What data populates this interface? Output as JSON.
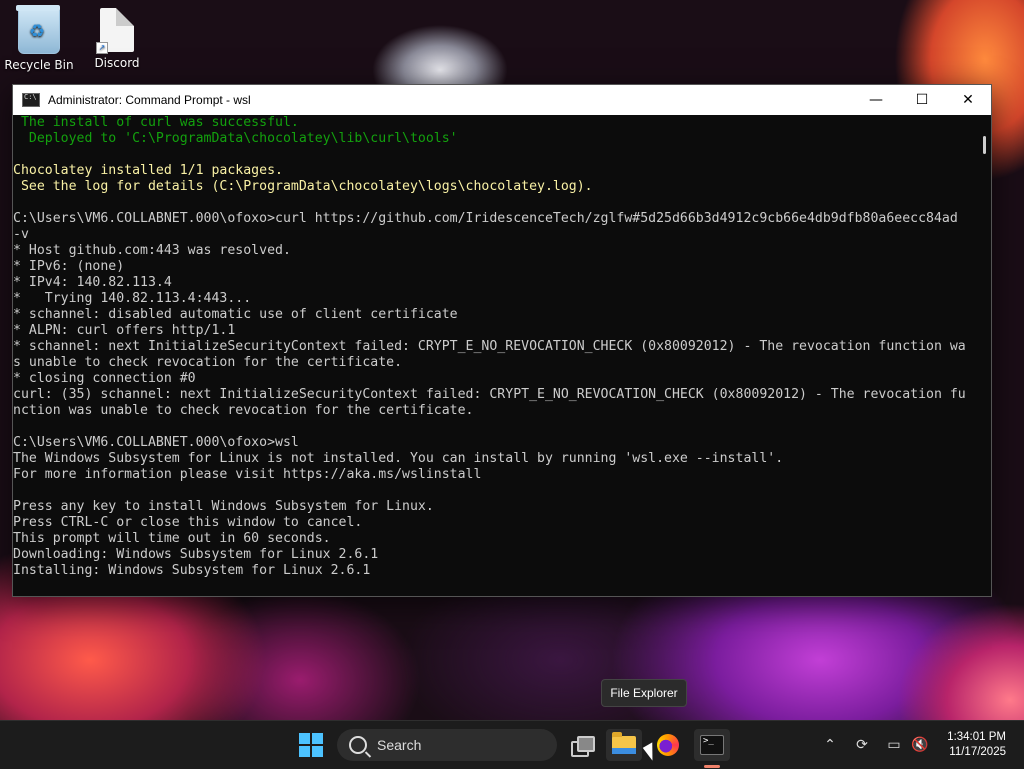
{
  "desktop": {
    "icons": [
      {
        "label": "Recycle Bin",
        "icon": "recycle-bin-icon"
      },
      {
        "label": "Discord",
        "icon": "discord-shortcut-icon"
      }
    ]
  },
  "window": {
    "title": "Administrator: Command Prompt - wsl",
    "minimize": "—",
    "maximize": "☐",
    "close": "✕"
  },
  "console": {
    "lines": [
      {
        "text": " The install of curl was successful.",
        "color": "green"
      },
      {
        "text": "  Deployed to 'C:\\ProgramData\\chocolatey\\lib\\curl\\tools'",
        "color": "green"
      },
      {
        "text": "",
        "color": ""
      },
      {
        "text": "Chocolatey installed 1/1 packages.",
        "color": "yellow"
      },
      {
        "text": " See the log for details (C:\\ProgramData\\chocolatey\\logs\\chocolatey.log).",
        "color": "yellow"
      },
      {
        "text": "",
        "color": ""
      },
      {
        "text": "C:\\Users\\VM6.COLLABNET.000\\ofoxo>curl https://github.com/IridescenceTech/zglfw#5d25d66b3d4912c9cb66e4db9dfb80a6eecc84ad",
        "color": ""
      },
      {
        "text": "-v",
        "color": ""
      },
      {
        "text": "* Host github.com:443 was resolved.",
        "color": ""
      },
      {
        "text": "* IPv6: (none)",
        "color": ""
      },
      {
        "text": "* IPv4: 140.82.113.4",
        "color": ""
      },
      {
        "text": "*   Trying 140.82.113.4:443...",
        "color": ""
      },
      {
        "text": "* schannel: disabled automatic use of client certificate",
        "color": ""
      },
      {
        "text": "* ALPN: curl offers http/1.1",
        "color": ""
      },
      {
        "text": "* schannel: next InitializeSecurityContext failed: CRYPT_E_NO_REVOCATION_CHECK (0x80092012) - The revocation function wa",
        "color": ""
      },
      {
        "text": "s unable to check revocation for the certificate.",
        "color": ""
      },
      {
        "text": "* closing connection #0",
        "color": ""
      },
      {
        "text": "curl: (35) schannel: next InitializeSecurityContext failed: CRYPT_E_NO_REVOCATION_CHECK (0x80092012) - The revocation fu",
        "color": ""
      },
      {
        "text": "nction was unable to check revocation for the certificate.",
        "color": ""
      },
      {
        "text": "",
        "color": ""
      },
      {
        "text": "C:\\Users\\VM6.COLLABNET.000\\ofoxo>wsl",
        "color": ""
      },
      {
        "text": "The Windows Subsystem for Linux is not installed. You can install by running 'wsl.exe --install'.",
        "color": ""
      },
      {
        "text": "For more information please visit https://aka.ms/wslinstall",
        "color": ""
      },
      {
        "text": "",
        "color": ""
      },
      {
        "text": "Press any key to install Windows Subsystem for Linux.",
        "color": ""
      },
      {
        "text": "Press CTRL-C or close this window to cancel.",
        "color": ""
      },
      {
        "text": "This prompt will time out in 60 seconds.",
        "color": ""
      },
      {
        "text": "Downloading: Windows Subsystem for Linux 2.6.1",
        "color": ""
      },
      {
        "text": "Installing: Windows Subsystem for Linux 2.6.1",
        "color": ""
      }
    ]
  },
  "tooltip": {
    "text": "File Explorer"
  },
  "taskbar": {
    "search_label": "Search",
    "clock_time": "1:34:01 PM",
    "clock_date": "11/17/2025",
    "accent": "#4cc2ff"
  }
}
